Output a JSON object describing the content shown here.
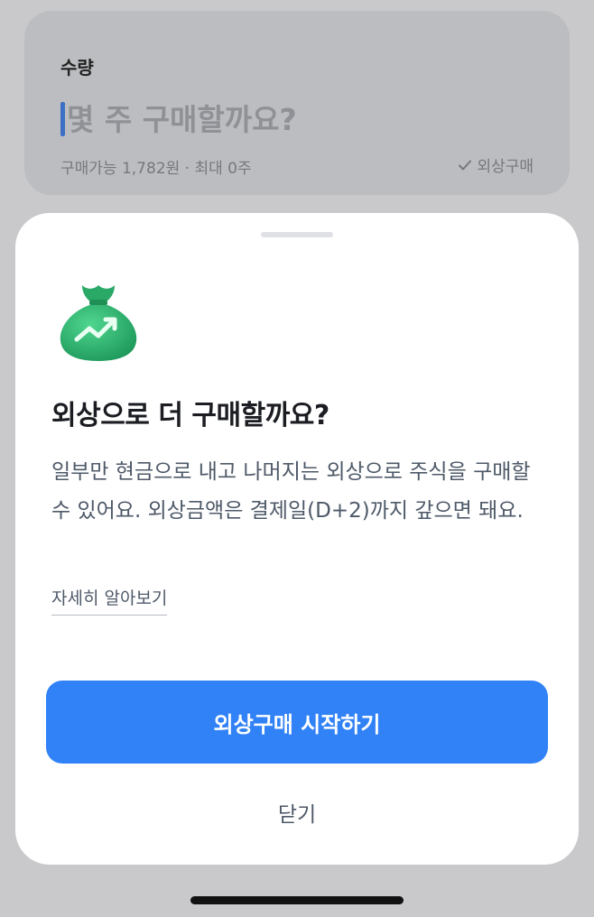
{
  "quantity": {
    "label": "수량",
    "placeholder": "몇 주 구매할까요?",
    "info": "구매가능 1,782원 · 최대 0주",
    "option_label": "외상구매",
    "option_icon": "check-icon"
  },
  "sheet": {
    "icon": "money-bag-icon",
    "title": "외상으로 더 구매할까요?",
    "description": "일부만 현금으로 내고 나머지는 외상으로 주식을 구매할 수 있어요. 외상금액은 결제일(D+2)까지 갚으면 돼요.",
    "learn_more": "자세히 알아보기",
    "primary_button": "외상구매 시작하기",
    "close_button": "닫기"
  },
  "colors": {
    "accent": "#3182f6",
    "bag_green": "#2fb36f"
  }
}
